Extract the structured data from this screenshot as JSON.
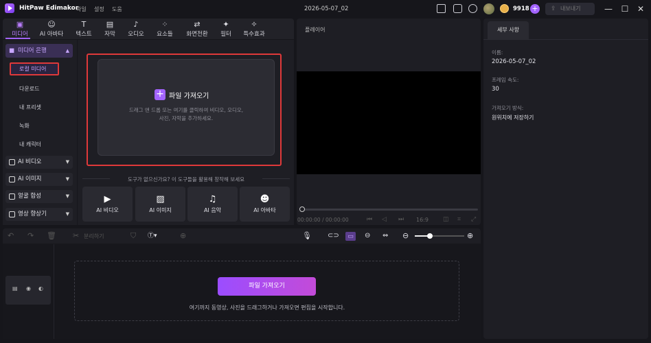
{
  "titlebar": {
    "app_name": "HitPaw Edimakor",
    "menus": [
      "파일",
      "설정",
      "도움"
    ],
    "project_title": "2026-05-07_02",
    "credits": "9918",
    "export_label": "내보내기",
    "icons": [
      "layout-icon",
      "feedback-icon",
      "download-icon",
      "avatar",
      "coin-icon",
      "add-credits-icon",
      "export-icon",
      "minimize-icon",
      "maximize-icon",
      "close-icon"
    ]
  },
  "tabs": [
    {
      "label": "미디어",
      "icon": "media-icon",
      "active": true
    },
    {
      "label": "AI 아바타",
      "icon": "avatar-icon"
    },
    {
      "label": "텍스트",
      "icon": "text-icon"
    },
    {
      "label": "자막",
      "icon": "subtitle-icon"
    },
    {
      "label": "오디오",
      "icon": "audio-icon"
    },
    {
      "label": "요소들",
      "icon": "elements-icon"
    },
    {
      "label": "화면전환",
      "icon": "transition-icon"
    },
    {
      "label": "필터",
      "icon": "filter-icon"
    },
    {
      "label": "특수효과",
      "icon": "effects-icon"
    }
  ],
  "sidebar": {
    "header": "미디어 은행",
    "selected": "로컬 미디어",
    "items": [
      "다운로드",
      "내 프리셋",
      "녹화",
      "내 캐릭터"
    ],
    "categories": [
      "AI 비디오",
      "AI 이미지",
      "얼굴 합성",
      "영상 향상기"
    ]
  },
  "import": {
    "label": "파일 가져오기",
    "hint_line1": "드래그 앤 드롭 또는 여기를 클릭하여 비디오, 오디오,",
    "hint_line2": "사진, 자막을 추가하세요."
  },
  "tools": {
    "title": "도구가 없으신가요? 이 도구들을 활용해 창작해 보세요",
    "cards": [
      {
        "label": "AI 비디오",
        "icon": "ai-video-icon"
      },
      {
        "label": "AI 이미지",
        "icon": "ai-image-icon"
      },
      {
        "label": "AI 음악",
        "icon": "ai-music-icon"
      },
      {
        "label": "AI 아바타",
        "icon": "ai-avatar-icon"
      }
    ]
  },
  "player": {
    "label": "플레이어",
    "timecode": "00:00:00 / 00:00:00",
    "ratio": "16:9"
  },
  "details": {
    "tab": "세부 사항",
    "name_label": "이름:",
    "name_value": "2026-05-07_02",
    "fps_label": "프레임 속도:",
    "fps_value": "30",
    "import_label": "가져오기 방식:",
    "import_value": "원위치에 저장하기"
  },
  "toolbar": {
    "split_label": "분리하기"
  },
  "timeline": {
    "import_button": "파일 가져오기",
    "hint": "여기까지 동영상, 사진을 드래그하거나 가져오면 편집을 시작합니다."
  }
}
